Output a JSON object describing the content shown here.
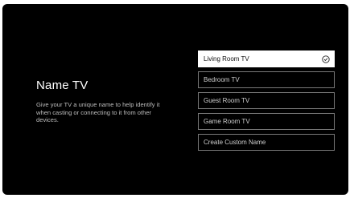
{
  "page": {
    "title": "Name TV",
    "description": "Give your TV a unique name to help identify it when casting or connecting to it from other devices."
  },
  "options": [
    {
      "label": "Living Room TV",
      "selected": true,
      "icon": "check-circle-icon"
    },
    {
      "label": "Bedroom TV",
      "selected": false
    },
    {
      "label": "Guest Room TV",
      "selected": false
    },
    {
      "label": "Game Room TV",
      "selected": false
    },
    {
      "label": "Create Custom Name",
      "selected": false
    }
  ],
  "colors": {
    "background": "#000000",
    "selected_background": "#ffffff",
    "option_border": "#7a7a7a"
  }
}
